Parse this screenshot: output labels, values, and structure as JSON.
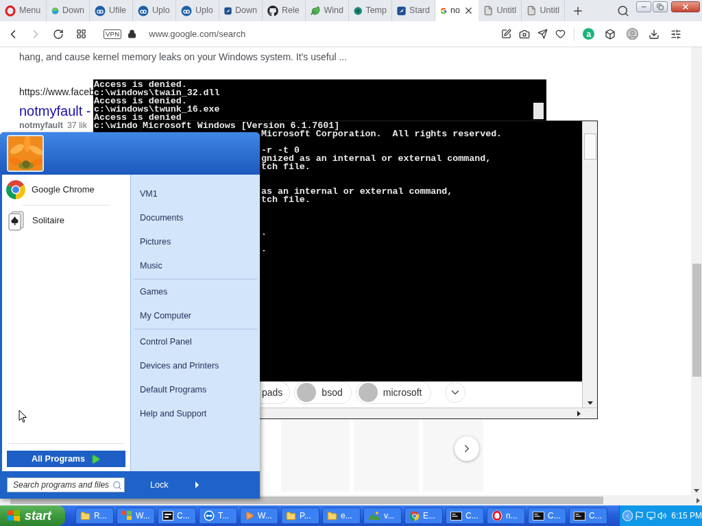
{
  "browser": {
    "tabs": [
      {
        "label": "Menu",
        "kind": "opera",
        "selected": false
      },
      {
        "label": "Down",
        "kind": "edge",
        "selected": false
      },
      {
        "label": "Ufile",
        "kind": "cloud",
        "selected": false
      },
      {
        "label": "Uplo",
        "kind": "cloud",
        "selected": false
      },
      {
        "label": "Uplo",
        "kind": "cloud",
        "selected": false
      },
      {
        "label": "Down",
        "kind": "star",
        "selected": false
      },
      {
        "label": "Rele",
        "kind": "github",
        "selected": false
      },
      {
        "label": "Wind",
        "kind": "leaf",
        "selected": false
      },
      {
        "label": "Temp",
        "kind": "teal",
        "selected": false
      },
      {
        "label": "Stard",
        "kind": "star",
        "selected": false
      },
      {
        "label": "no",
        "kind": "google",
        "selected": true
      },
      {
        "label": "Untitl",
        "kind": "doc",
        "selected": false
      },
      {
        "label": "Untitl",
        "kind": "doc",
        "selected": false
      }
    ],
    "vpn": "VPN",
    "address": "www.google.com/search",
    "extension_badge": "a"
  },
  "page": {
    "snippet": "hang, and cause kernel memory leaks on your Windows system. It's useful ...",
    "url": "https://www.faceb",
    "result_title": "notmyfault -",
    "meta_source": "notmyfault",
    "meta_likes": "37 lik",
    "chips": [
      "pads",
      "bsod",
      "microsoft"
    ]
  },
  "console_back": {
    "lines": [
      "Access is denied.",
      "c:\\windows\\twain_32.dll",
      "Access is denied.",
      "c:\\windows\\twunk_16.exe",
      "Access is denied",
      "c:\\windo"
    ]
  },
  "console_front": {
    "header": "Microsoft Windows [Version 6.1.7601]",
    "lines": [
      "Microsoft Corporation.  All rights reserved.",
      "-r -t 0",
      "gnized as an internal or external command,",
      "tch file.",
      "as an internal or external command,",
      "tch file.",
      ".",
      "."
    ]
  },
  "start_menu": {
    "pinned": [
      "Google Chrome",
      "Solitaire"
    ],
    "all_programs": "All Programs",
    "places": [
      [
        "VM1",
        "Documents",
        "Pictures",
        "Music"
      ],
      [
        "Games",
        "My Computer"
      ],
      [
        "Control Panel",
        "Devices and Printers",
        "Default Programs",
        "Help and Support"
      ]
    ],
    "search": {
      "placeholder": "Search programs and files"
    },
    "lock": "Lock"
  },
  "taskbar": {
    "start": "start",
    "buttons": [
      {
        "label": "R...",
        "kind": "folder"
      },
      {
        "label": "W...",
        "kind": "windows"
      },
      {
        "label": "C...",
        "kind": "archive"
      },
      {
        "label": "T...",
        "kind": "remote"
      },
      {
        "label": "W...",
        "kind": "media"
      },
      {
        "label": "P...",
        "kind": "folder"
      },
      {
        "label": "e...",
        "kind": "folder"
      },
      {
        "label": "v..."
      },
      {
        "label": "E...",
        "kind": "chrome"
      },
      {
        "label": "C...",
        "kind": "console"
      },
      {
        "label": "n...",
        "kind": "opera"
      },
      {
        "label": "C...",
        "kind": "console"
      },
      {
        "label": "C...",
        "kind": "console"
      }
    ],
    "clock": "6:15 PM"
  }
}
